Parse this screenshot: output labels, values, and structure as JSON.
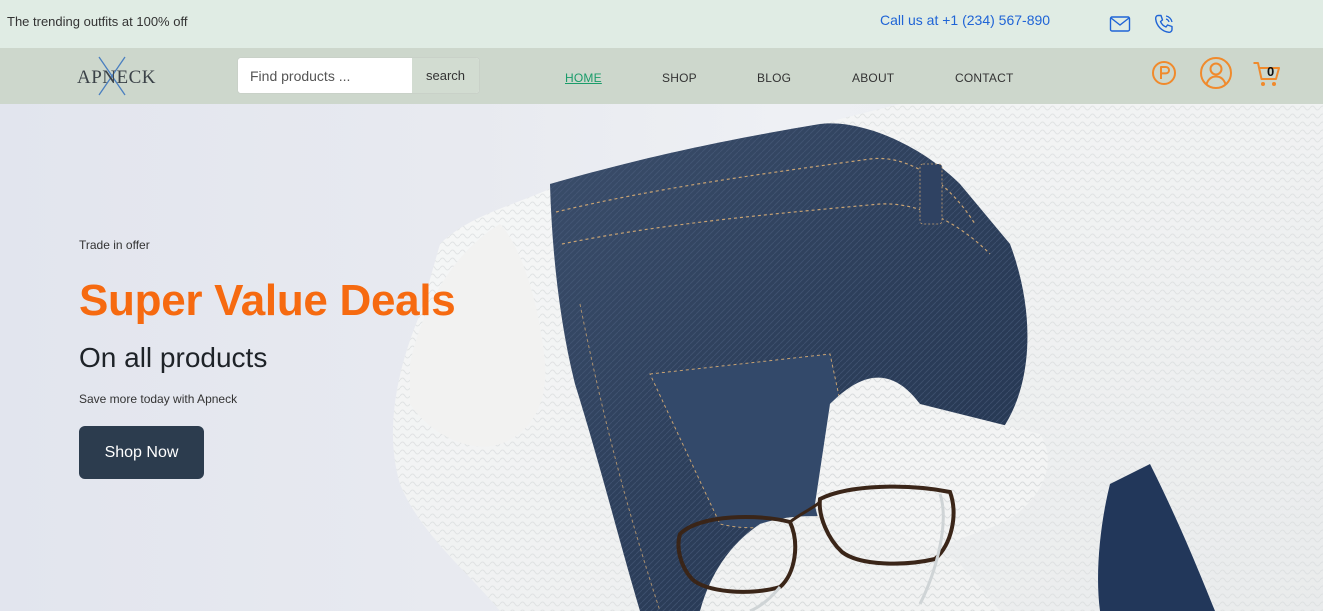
{
  "topbar": {
    "promo_text": "The trending outfits at 100% off",
    "call_text": "Call us at +1 (234) 567-890",
    "icons": [
      "mail-icon",
      "phone-icon"
    ]
  },
  "nav": {
    "logo_text": "APNECK",
    "search_placeholder": "Find products ...",
    "search_button": "search",
    "menu": [
      {
        "label": "HOME",
        "active": true
      },
      {
        "label": "SHOP",
        "active": false
      },
      {
        "label": "BLOG",
        "active": false
      },
      {
        "label": "ABOUT",
        "active": false
      },
      {
        "label": "CONTACT",
        "active": false
      }
    ],
    "icons": [
      "points-icon",
      "user-icon",
      "cart-icon"
    ],
    "cart_count": "0"
  },
  "hero": {
    "eyebrow": "Trade in offer",
    "headline": "Super Value Deals",
    "subheadline": "On all products",
    "description": "Save more today with Apneck",
    "cta_label": "Shop Now"
  },
  "colors": {
    "topbar_bg": "#e0ece4",
    "nav_bg": "#cdd7cc",
    "accent_orange": "#f66a10",
    "link_blue": "#1f64d6",
    "active_green": "#1a9c6a",
    "button_dark": "#2c3c4e"
  }
}
